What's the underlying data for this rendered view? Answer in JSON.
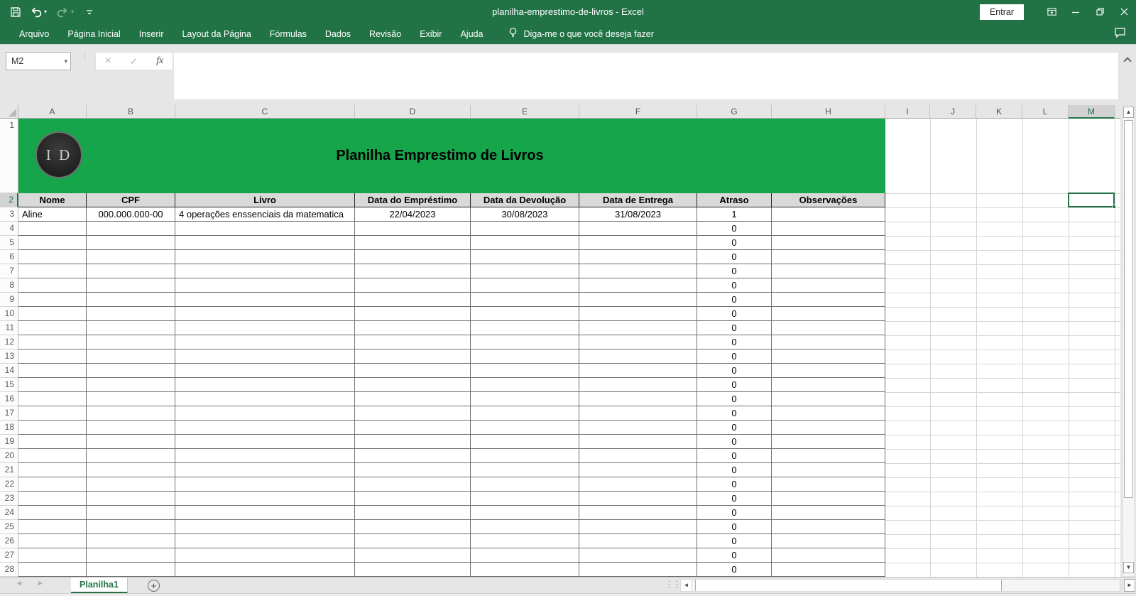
{
  "window": {
    "title": "planilha-emprestimo-de-livros  -  Excel",
    "sign_in": "Entrar"
  },
  "ribbon": {
    "tabs": [
      "Arquivo",
      "Página Inicial",
      "Inserir",
      "Layout da Página",
      "Fórmulas",
      "Dados",
      "Revisão",
      "Exibir",
      "Ajuda"
    ],
    "tell_me": "Diga-me o que você deseja fazer"
  },
  "formula_bar": {
    "cell_reference": "M2",
    "formula": "",
    "fx_label": "fx",
    "cancel_glyph": "×",
    "enter_glyph": "✓"
  },
  "sheet": {
    "column_letters": [
      "A",
      "B",
      "C",
      "D",
      "E",
      "F",
      "G",
      "H",
      "I",
      "J",
      "K",
      "L",
      "M"
    ],
    "visible_rows": 28,
    "selected_cell": "M2",
    "selected_column": "M",
    "selected_row": 2,
    "banner": {
      "title": "Planilha Emprestimo de Livros",
      "logo_text": "I D"
    },
    "table": {
      "headers": [
        "Nome",
        "CPF",
        "Livro",
        "Data do Empréstimo",
        "Data da Devolução",
        "Data de Entrega",
        "Atraso",
        "Observações"
      ],
      "data_row": [
        "Aline",
        "000.000.000-00",
        "4 operações enssenciais da matematica",
        "22/04/2023",
        "30/08/2023",
        "31/08/2023",
        "1",
        ""
      ],
      "default_atraso": "0"
    }
  },
  "sheet_tabs": {
    "active": "Planilha1"
  },
  "colors": {
    "excel_green": "#217346",
    "banner_green": "#17A54B",
    "header_fill": "#D9D9D9",
    "selection_green": "#217346"
  }
}
